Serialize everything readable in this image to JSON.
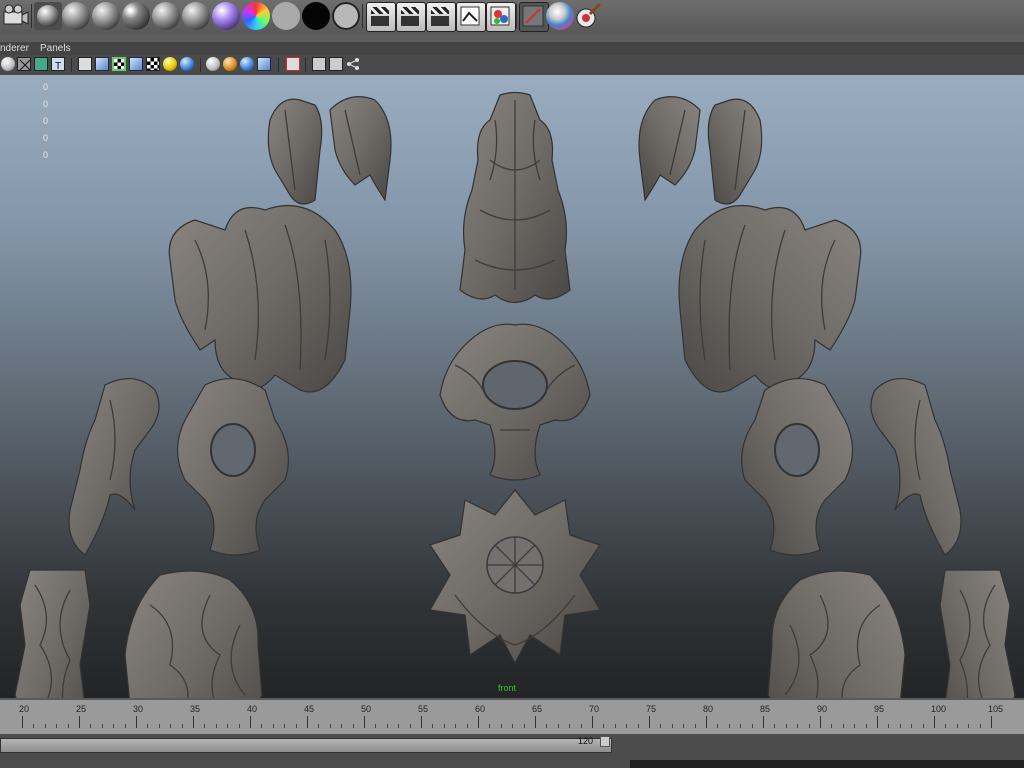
{
  "menubar": {
    "items": [
      "nderer",
      "Panels"
    ]
  },
  "viewport": {
    "hud_values": [
      "0",
      "0",
      "0",
      "0",
      "0"
    ],
    "camera_label": "front"
  },
  "timeline": {
    "ticks": [
      "20",
      "25",
      "30",
      "35",
      "40",
      "45",
      "50",
      "55",
      "60",
      "65",
      "70",
      "75",
      "80",
      "85",
      "90",
      "95",
      "100",
      "105"
    ]
  },
  "range": {
    "end_value": "120"
  },
  "shelf_icons": [
    "render-view-icon",
    "phong-sphere-icon",
    "grey-sphere-icon",
    "blinn-sphere-icon",
    "lambert-sphere-icon",
    "anisotropic-sphere-icon",
    "violet-shader-sphere-icon",
    "ramp-shader-sphere-icon",
    "flat-grey-swatch-icon",
    "black-swatch-icon",
    "outline-swatch-icon",
    "clapboard-render-icon",
    "clapboard-batch-icon",
    "clapboard-ipr-icon",
    "texture-editor-icon",
    "hypershade-icon",
    "render-settings-icon",
    "toon-shader-icon",
    "paint-brush-icon"
  ]
}
